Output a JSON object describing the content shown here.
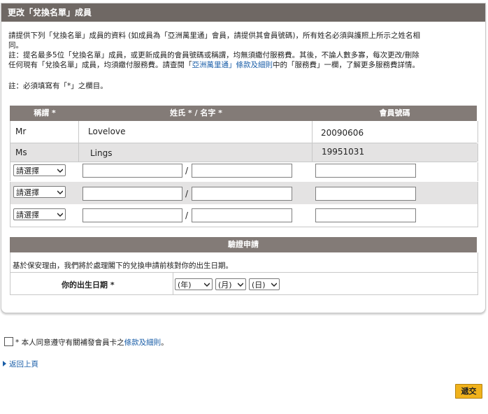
{
  "panel": {
    "title": "更改「兌換名單」成員",
    "intro_line1": "請提供下列「兌換名單」成員的資料 (如成員為「亞洲萬里通」會員，請提供其會員號碼)，所有姓名必須與護照上所示之姓名相",
    "intro_line2": "同。",
    "intro_line3": "註：提名最多5位「兌換名單」成員，或更新成員的會員號碼或稱謂，均無須繳付服務費。其後，不論人數多寡，每次更改/刪除",
    "intro_line4_a": "任何現有「兌換名單」成員，均須繳付服務費。請查閱「",
    "intro_line4_link": "亞洲萬里通」條款及細則",
    "intro_line4_b": "中的「服務費」一欄，了解更多服務費詳情。",
    "required_note": "註：必須填寫有「*」之欄目。"
  },
  "table": {
    "headers": {
      "title": "稱謂 *",
      "name": "姓氏 * / 名字 *",
      "member_no": "會員號碼"
    },
    "rows": [
      {
        "title": "Mr",
        "name": "Lovelove",
        "member_no": "20090606"
      },
      {
        "title": "Ms",
        "name": "Lings",
        "member_no": "19951031"
      }
    ],
    "select_placeholder": "請選擇",
    "slash": "/"
  },
  "verify": {
    "header": "驗證申請",
    "text": "基於保安理由，我們將於處理閣下的兌換申請前核對你的出生日期。",
    "dob_label": "你的出生日期 *",
    "year": "(年)",
    "month": "(月)",
    "day": "(日)"
  },
  "agree": {
    "prefix": "* 本人同意遵守有關補發會員卡之",
    "link": "條款及細則",
    "suffix": "。"
  },
  "back_link": "返回上頁",
  "submit_label": "遞交",
  "colors": {
    "header_bg": "#6f6864",
    "table_head_bg": "#837b77",
    "link": "#1a5ea8",
    "submit_bg": "#f0b21c"
  }
}
